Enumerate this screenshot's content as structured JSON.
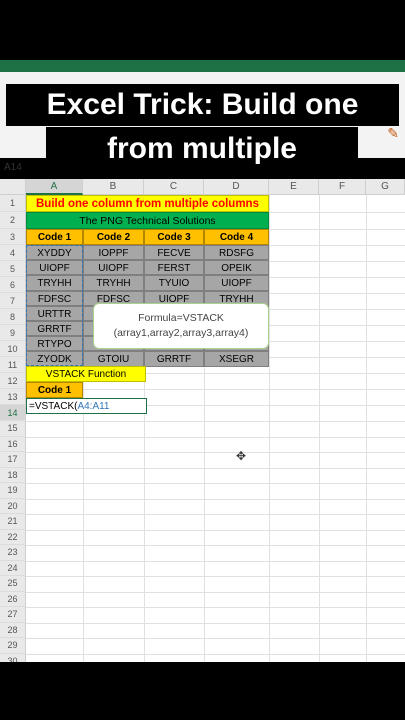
{
  "title": {
    "line1": "Excel Trick: Build one column",
    "line2": "from multiple columns."
  },
  "name_box": "A14",
  "columns": [
    "A",
    "B",
    "C",
    "D",
    "E",
    "F",
    "G"
  ],
  "rows": [
    "1",
    "2",
    "3",
    "4",
    "5",
    "6",
    "7",
    "8",
    "9",
    "10",
    "11",
    "12",
    "13",
    "14",
    "15",
    "16",
    "17",
    "18",
    "19",
    "20",
    "21",
    "22",
    "23",
    "24",
    "25",
    "26",
    "27",
    "28",
    "29",
    "30"
  ],
  "header_row1": "Build one column from multiple columns",
  "header_row2": "The PNG Technical Solutions",
  "table": {
    "headers": [
      "Code 1",
      "Code 2",
      "Code 3",
      "Code 4"
    ],
    "rows": [
      [
        "XYDDY",
        "IOPPF",
        "FECVE",
        "RDSFG"
      ],
      [
        "UIOPF",
        "UIOPF",
        "FERST",
        "OPEIK"
      ],
      [
        "TRYHH",
        "TRYHH",
        "TYUIO",
        "UIOPF"
      ],
      [
        "FDFSC",
        "FDFSC",
        "UIOPF",
        "TRYHH"
      ],
      [
        "URTTR",
        "",
        "",
        ""
      ],
      [
        "GRRTF",
        "",
        "",
        ""
      ],
      [
        "RTYPO",
        "",
        "",
        ""
      ],
      [
        "ZYODK",
        "GTOIU",
        "GRRTF",
        "XSEGR"
      ]
    ]
  },
  "vstack_label": "VSTACK Function",
  "result_header": "Code 1",
  "formula_cell": {
    "prefix": "=VSTACK(",
    "range": "A4:A11"
  },
  "tooltip": {
    "line1": "Formula=VSTACK",
    "line2": "(array1,array2,array3,array4)"
  },
  "colors": {
    "yellow": "#ffff00",
    "green": "#00b050",
    "orange": "#ffc000",
    "gray": "#a6a6a6",
    "excel_green": "#1e7145",
    "red_text": "#ff0000"
  }
}
